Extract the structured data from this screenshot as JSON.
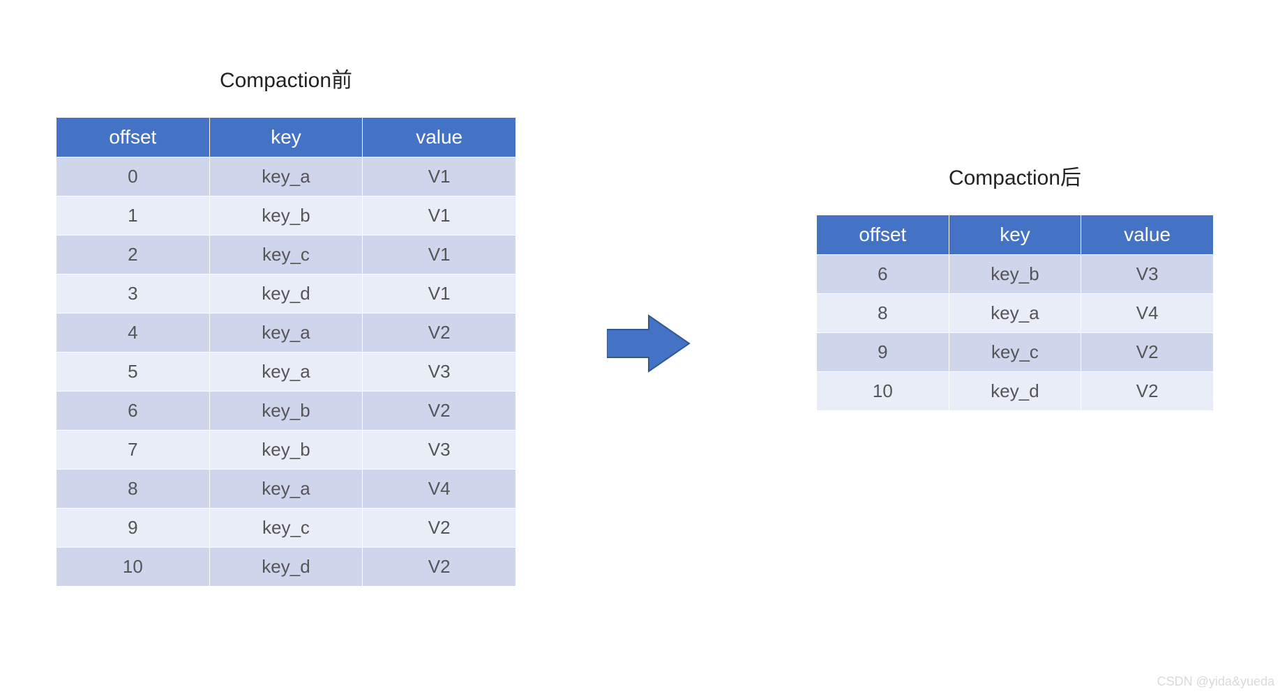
{
  "before": {
    "title": "Compaction前",
    "headers": [
      "offset",
      "key",
      "value"
    ],
    "rows": [
      {
        "offset": "0",
        "key": "key_a",
        "value": "V1"
      },
      {
        "offset": "1",
        "key": "key_b",
        "value": "V1"
      },
      {
        "offset": "2",
        "key": "key_c",
        "value": "V1"
      },
      {
        "offset": "3",
        "key": "key_d",
        "value": "V1"
      },
      {
        "offset": "4",
        "key": "key_a",
        "value": "V2"
      },
      {
        "offset": "5",
        "key": "key_a",
        "value": "V3"
      },
      {
        "offset": "6",
        "key": "key_b",
        "value": "V2"
      },
      {
        "offset": "7",
        "key": "key_b",
        "value": "V3"
      },
      {
        "offset": "8",
        "key": "key_a",
        "value": "V4"
      },
      {
        "offset": "9",
        "key": "key_c",
        "value": "V2"
      },
      {
        "offset": "10",
        "key": "key_d",
        "value": "V2"
      }
    ]
  },
  "after": {
    "title": "Compaction后",
    "headers": [
      "offset",
      "key",
      "value"
    ],
    "rows": [
      {
        "offset": "6",
        "key": "key_b",
        "value": "V3"
      },
      {
        "offset": "8",
        "key": "key_a",
        "value": "V4"
      },
      {
        "offset": "9",
        "key": "key_c",
        "value": "V2"
      },
      {
        "offset": "10",
        "key": "key_d",
        "value": "V2"
      }
    ]
  },
  "arrow": {
    "color": "#4472c4",
    "stroke": "#2f598f"
  },
  "watermark": "CSDN @yida&yueda"
}
